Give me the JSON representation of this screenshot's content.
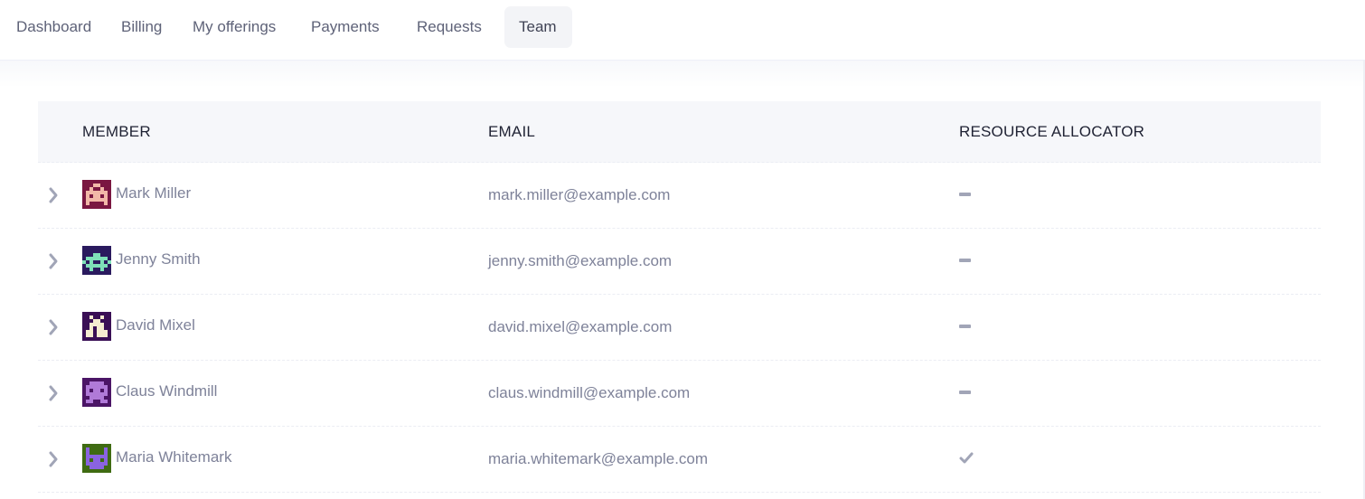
{
  "tabs": [
    {
      "label": "Dashboard",
      "active": false
    },
    {
      "label": "Billing",
      "active": false
    },
    {
      "label": "My offerings",
      "active": false
    },
    {
      "label": "Payments",
      "active": false
    },
    {
      "label": "Requests",
      "active": false
    },
    {
      "label": "Team",
      "active": true
    }
  ],
  "table": {
    "columns": [
      "MEMBER",
      "EMAIL",
      "RESOURCE ALLOCATOR"
    ],
    "rows": [
      {
        "name": "Mark Miller",
        "email": "mark.miller@example.com",
        "resource_allocator": false,
        "avatar": "pixel-avatar-maroon"
      },
      {
        "name": "Jenny Smith",
        "email": "jenny.smith@example.com",
        "resource_allocator": false,
        "avatar": "pixel-avatar-navy"
      },
      {
        "name": "David Mixel",
        "email": "david.mixel@example.com",
        "resource_allocator": false,
        "avatar": "pixel-avatar-purple"
      },
      {
        "name": "Claus Windmill",
        "email": "claus.windmill@example.com",
        "resource_allocator": false,
        "avatar": "pixel-avatar-violet"
      },
      {
        "name": "Maria Whitemark",
        "email": "maria.whitemark@example.com",
        "resource_allocator": true,
        "avatar": "pixel-avatar-green"
      }
    ]
  },
  "icons": {
    "expand": "chevron-right-icon",
    "not_allocator": "dash-icon",
    "allocator": "check-icon"
  },
  "colors": {
    "active_tab_bg": "#f3f4f7",
    "header_bg": "#f6f7fa",
    "muted_text": "#7e8299",
    "icon_gray": "#a1a5b7"
  }
}
